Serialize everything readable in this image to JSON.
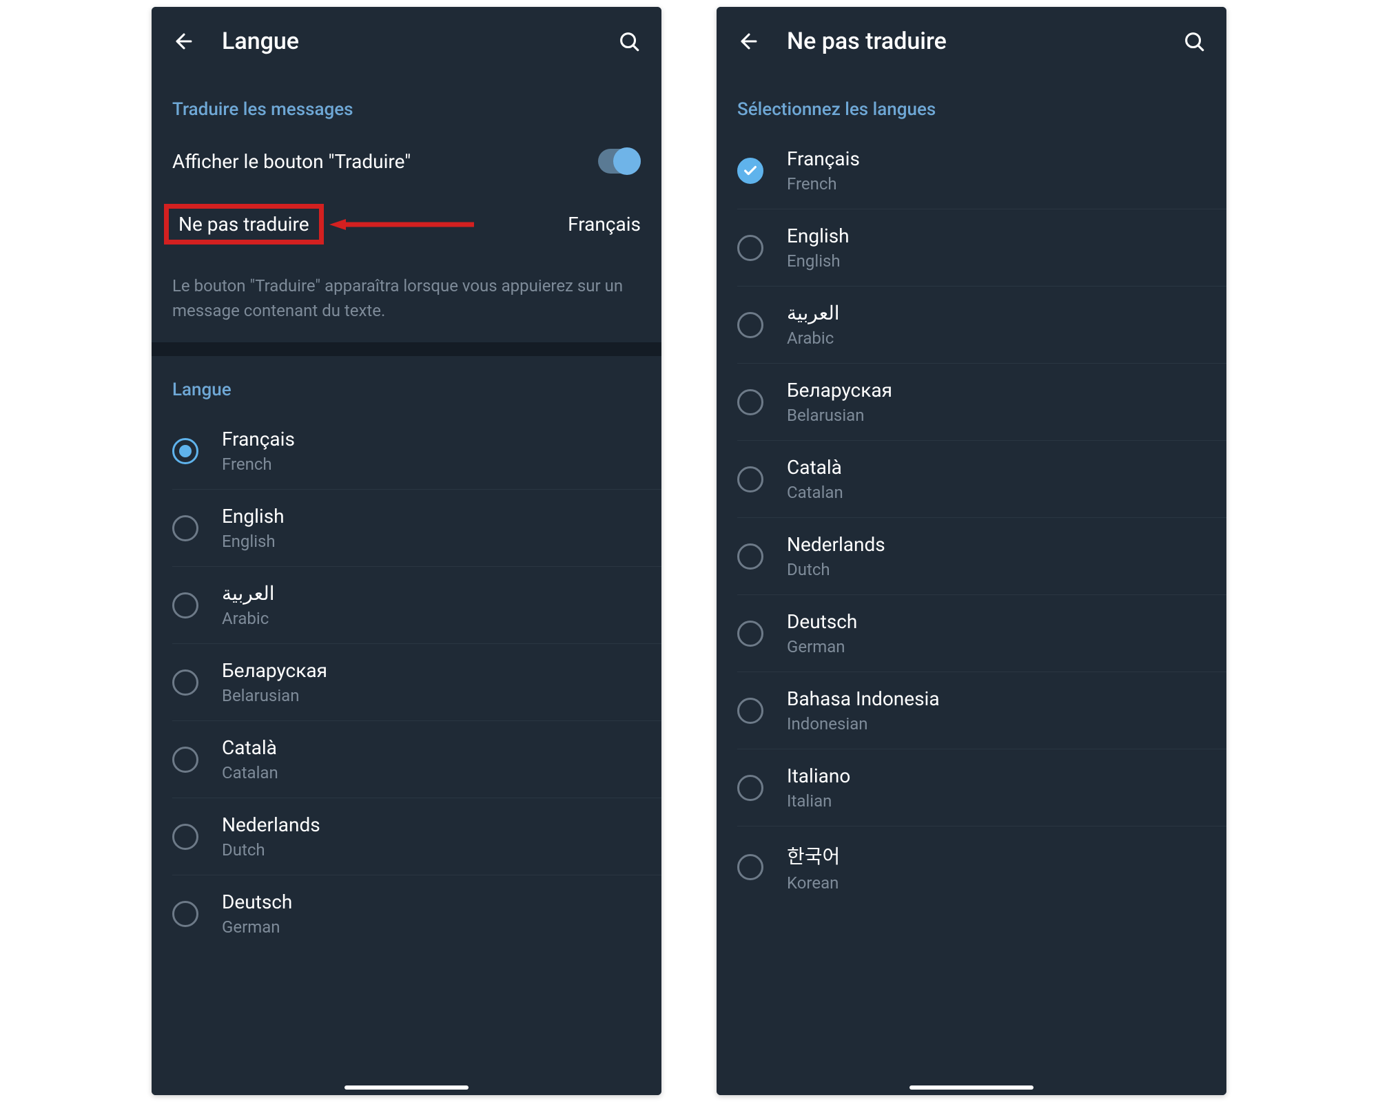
{
  "left": {
    "title": "Langue",
    "translate_section": "Traduire les messages",
    "show_button_label": "Afficher le bouton \"Traduire\"",
    "do_not_translate_label": "Ne pas traduire",
    "do_not_translate_value": "Français",
    "description": "Le bouton \"Traduire\" apparaîtra lorsque vous appuierez sur un message contenant du texte.",
    "language_section": "Langue",
    "languages": [
      {
        "native": "Français",
        "english": "French",
        "selected": true
      },
      {
        "native": "English",
        "english": "English",
        "selected": false
      },
      {
        "native": "العربية",
        "english": "Arabic",
        "selected": false
      },
      {
        "native": "Беларуская",
        "english": "Belarusian",
        "selected": false
      },
      {
        "native": "Català",
        "english": "Catalan",
        "selected": false
      },
      {
        "native": "Nederlands",
        "english": "Dutch",
        "selected": false
      },
      {
        "native": "Deutsch",
        "english": "German",
        "selected": false
      }
    ]
  },
  "right": {
    "title": "Ne pas traduire",
    "section_header": "Sélectionnez les langues",
    "languages": [
      {
        "native": "Français",
        "english": "French",
        "checked": true
      },
      {
        "native": "English",
        "english": "English",
        "checked": false
      },
      {
        "native": "العربية",
        "english": "Arabic",
        "checked": false
      },
      {
        "native": "Беларуская",
        "english": "Belarusian",
        "checked": false
      },
      {
        "native": "Català",
        "english": "Catalan",
        "checked": false
      },
      {
        "native": "Nederlands",
        "english": "Dutch",
        "checked": false
      },
      {
        "native": "Deutsch",
        "english": "German",
        "checked": false
      },
      {
        "native": "Bahasa Indonesia",
        "english": "Indonesian",
        "checked": false
      },
      {
        "native": "Italiano",
        "english": "Italian",
        "checked": false
      },
      {
        "native": "한국어",
        "english": "Korean",
        "checked": false
      }
    ]
  },
  "colors": {
    "bg": "#1f2a36",
    "accent": "#6fa8d6",
    "toggle": "#6fb4e8",
    "highlight": "#d32020",
    "muted": "#7e8b99"
  },
  "icons": {
    "back": "back-arrow-icon",
    "search": "search-icon",
    "check": "check-icon",
    "arrow_left": "arrow-left-icon"
  }
}
